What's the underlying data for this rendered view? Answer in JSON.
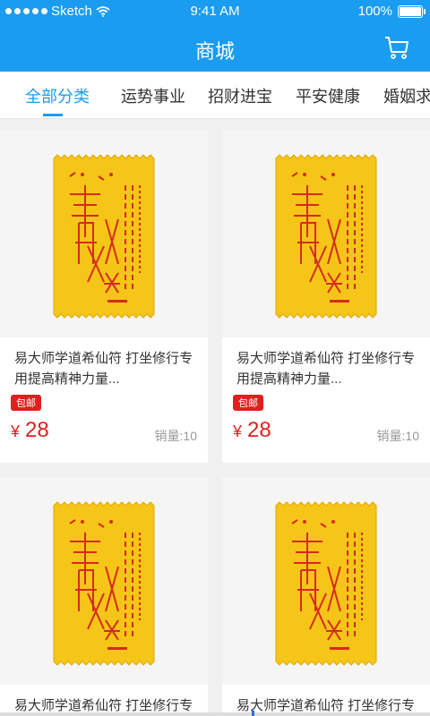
{
  "status": {
    "carrier": "Sketch",
    "time": "9:41 AM",
    "battery": "100%"
  },
  "header": {
    "title": "商城",
    "cart_icon": "cart-icon"
  },
  "tabs": [
    {
      "label": "全部分类",
      "active": true
    },
    {
      "label": "运势事业",
      "active": false
    },
    {
      "label": "招财进宝",
      "active": false
    },
    {
      "label": "平安健康",
      "active": false
    },
    {
      "label": "婚姻求",
      "active": false
    }
  ],
  "products": [
    {
      "name": "易大师学道希仙符 打坐修行专用提高精神力量...",
      "badge": "包邮",
      "currency": "¥",
      "price": "28",
      "sales": "销量:10"
    },
    {
      "name": "易大师学道希仙符 打坐修行专用提高精神力量...",
      "badge": "包邮",
      "currency": "¥",
      "price": "28",
      "sales": "销量:10"
    },
    {
      "name": "易大师学道希仙符 打坐修行专",
      "badge": "",
      "currency": "",
      "price": "",
      "sales": ""
    },
    {
      "name": "易大师学道希仙符 打坐修行专",
      "badge": "",
      "currency": "",
      "price": "",
      "sales": ""
    }
  ],
  "colors": {
    "primary": "#1a9cf0",
    "accent_red": "#e02020",
    "talisman_yellow": "#f5c518",
    "talisman_ink": "#d62a1e"
  }
}
